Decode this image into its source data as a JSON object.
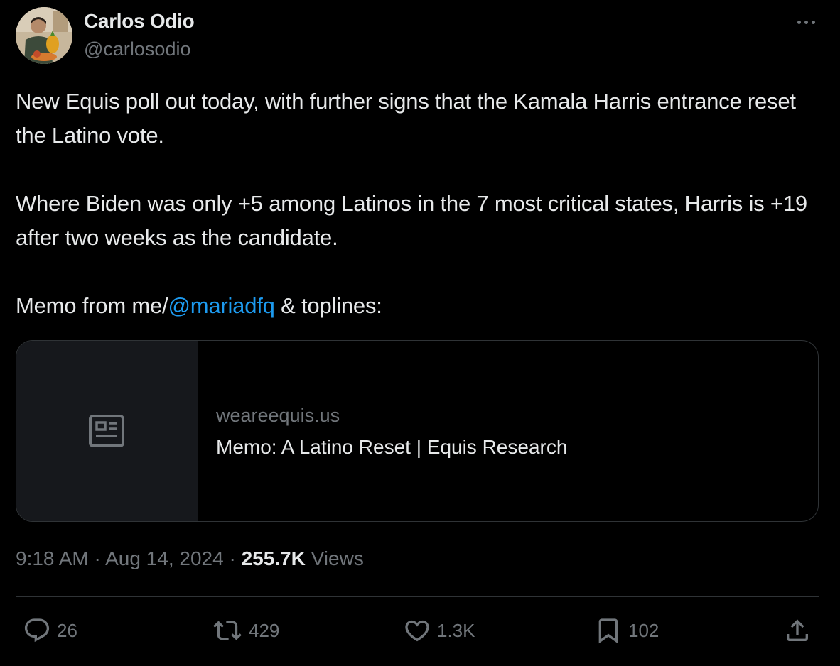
{
  "author": {
    "display_name": "Carlos Odio",
    "handle": "@carlosodio"
  },
  "tweet": {
    "paragraphs": [
      "New Equis poll out today, with further signs that the Kamala Harris entrance reset the Latino vote.",
      "Where Biden was only +5 among Latinos in the 7 most critical states, Harris is +19 after two weeks as the candidate."
    ],
    "memo_prefix": "Memo from me/",
    "mention": "@mariadfq",
    "memo_suffix": " & toplines:"
  },
  "link_card": {
    "domain": "weareequis.us",
    "title": "Memo: A Latino Reset | Equis Research",
    "icon": "article-icon"
  },
  "meta": {
    "time": "9:18 AM",
    "separator": " · ",
    "date": "Aug 14, 2024",
    "separator2": " · ",
    "views_count": "255.7K",
    "views_label": " Views"
  },
  "actions": {
    "replies": "26",
    "reposts": "429",
    "likes": "1.3K",
    "bookmarks": "102"
  },
  "colors": {
    "background": "#000000",
    "text": "#e7e9ea",
    "secondary": "#71767b",
    "link": "#1d9bf0",
    "border": "#2f3336"
  }
}
